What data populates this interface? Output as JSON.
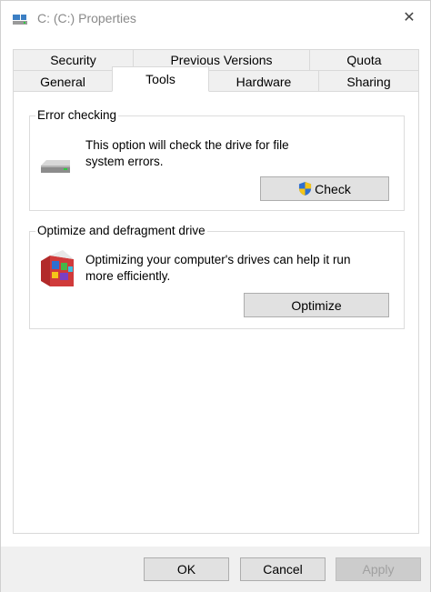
{
  "window": {
    "title": "C: (C:) Properties",
    "close_glyph": "✕"
  },
  "tabs": {
    "top_row": [
      {
        "label": "Security"
      },
      {
        "label": "Previous Versions"
      },
      {
        "label": "Quota"
      }
    ],
    "bottom_row": [
      {
        "label": "General"
      },
      {
        "label": "Tools"
      },
      {
        "label": "Hardware"
      },
      {
        "label": "Sharing"
      }
    ],
    "active": "Tools"
  },
  "error_checking": {
    "legend": "Error checking",
    "description_line1": "This option will check the drive for file",
    "description_line2": "system errors.",
    "button_label": "Check",
    "icon": "drive-icon",
    "button_icon": "uac-shield-icon"
  },
  "optimize": {
    "legend": "Optimize and defragment drive",
    "description_line1": "Optimizing your computer's drives can help it run",
    "description_line2": "more efficiently.",
    "button_label": "Optimize",
    "icon": "defrag-icon"
  },
  "footer": {
    "ok_label": "OK",
    "cancel_label": "Cancel",
    "apply_label": "Apply",
    "apply_enabled": false
  },
  "colors": {
    "title_text": "#8a8a8a",
    "tab_bg": "#f0f0f0",
    "border": "#d9d9d9",
    "button_bg": "#e1e1e1",
    "disabled_text": "#a0a0a0"
  }
}
